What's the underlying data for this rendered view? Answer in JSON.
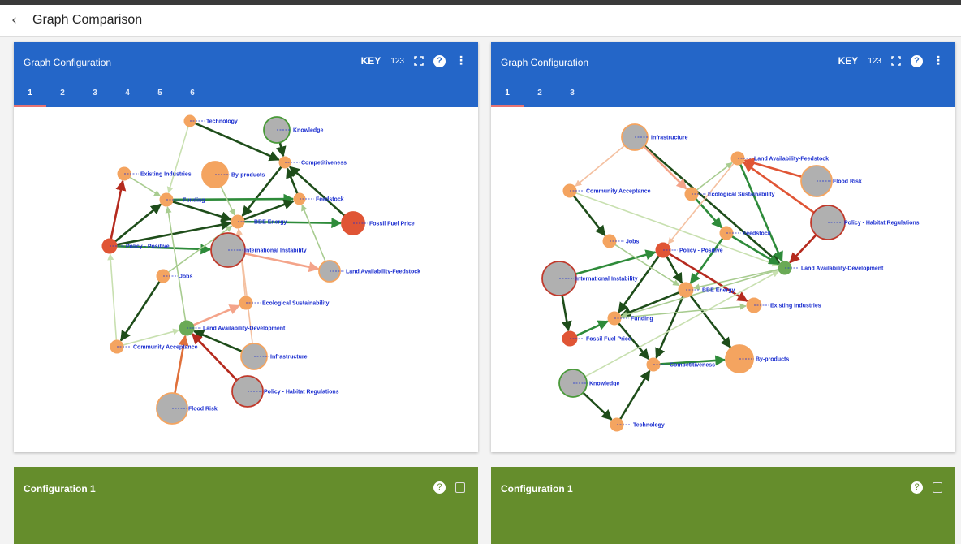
{
  "header": {
    "back_icon": "chevron-left-icon",
    "title": "Graph Comparison"
  },
  "panels": [
    {
      "title": "Graph Configuration",
      "key_label": "KEY",
      "count_label": "123",
      "tabs": [
        "1",
        "2",
        "3",
        "4",
        "5",
        "6"
      ],
      "active_tab": "1",
      "graph": {
        "nodes": [
          {
            "id": "technology",
            "label": "Technology",
            "fill": "#f4a460",
            "border": "#f4a460"
          },
          {
            "id": "knowledge",
            "label": "Knowledge",
            "fill": "#b0b0b0",
            "border": "#4a9a3a"
          },
          {
            "id": "competitiveness",
            "label": "Competitiveness",
            "fill": "#f4a460",
            "border": "#f4a460"
          },
          {
            "id": "existing_industries",
            "label": "Existing Industries",
            "fill": "#f4a460",
            "border": "#f4a460"
          },
          {
            "id": "byproducts",
            "label": "By-products",
            "fill": "#f4a460",
            "border": "#f4a460"
          },
          {
            "id": "funding",
            "label": "Funding",
            "fill": "#f4a460",
            "border": "#f4a460"
          },
          {
            "id": "feedstock",
            "label": "Feedstock",
            "fill": "#f4a460",
            "border": "#f4a460"
          },
          {
            "id": "bbe_energy",
            "label": "BBE Energy",
            "fill": "#f4a460",
            "border": "#f4a460"
          },
          {
            "id": "fossil_fuel_price",
            "label": "Fossil Fuel Price",
            "fill": "#e05535",
            "border": "#e05535"
          },
          {
            "id": "policy_positive",
            "label": "Policy - Positive",
            "fill": "#e05535",
            "border": "#e05535"
          },
          {
            "id": "international_instability",
            "label": "International Instability",
            "fill": "#b0b0b0",
            "border": "#c0392b"
          },
          {
            "id": "land_feedstock",
            "label": "Land Availability-Feedstock",
            "fill": "#b0b0b0",
            "border": "#f4a460"
          },
          {
            "id": "jobs",
            "label": "Jobs",
            "fill": "#f4a460",
            "border": "#f4a460"
          },
          {
            "id": "ecological",
            "label": "Ecological Sustainability",
            "fill": "#f4a460",
            "border": "#f4a460"
          },
          {
            "id": "land_development",
            "label": "Land Availability-Development",
            "fill": "#6aaa56",
            "border": "#6aaa56"
          },
          {
            "id": "community",
            "label": "Community Acceptance",
            "fill": "#f4a460",
            "border": "#f4a460"
          },
          {
            "id": "infrastructure",
            "label": "Infrastructure",
            "fill": "#b0b0b0",
            "border": "#f4a460"
          },
          {
            "id": "policy_habitat",
            "label": "Policy - Habitat Regulations",
            "fill": "#b0b0b0",
            "border": "#c0392b"
          },
          {
            "id": "flood_risk",
            "label": "Flood Risk",
            "fill": "#b0b0b0",
            "border": "#f4a460"
          }
        ],
        "edges": [
          [
            "technology",
            "competitiveness",
            "#1e4d1a"
          ],
          [
            "knowledge",
            "competitiveness",
            "#1e4d1a"
          ],
          [
            "competitiveness",
            "bbe_energy",
            "#1e4d1a"
          ],
          [
            "feedstock",
            "competitiveness",
            "#1e4d1a"
          ],
          [
            "policy_positive",
            "existing_industries",
            "#b52a1e"
          ],
          [
            "policy_positive",
            "funding",
            "#1e4d1a"
          ],
          [
            "funding",
            "bbe_energy",
            "#1e4d1a"
          ],
          [
            "funding",
            "feedstock",
            "#2e8b3a"
          ],
          [
            "bbe_energy",
            "feedstock",
            "#1e4d1a"
          ],
          [
            "bbe_energy",
            "fossil_fuel_price",
            "#2e8b3a"
          ],
          [
            "policy_positive",
            "bbe_energy",
            "#1e4d1a"
          ],
          [
            "policy_positive",
            "international_instability",
            "#2e8b3a"
          ],
          [
            "international_instability",
            "land_feedstock",
            "#f4a48a"
          ],
          [
            "jobs",
            "community",
            "#1e4d1a"
          ],
          [
            "infrastructure",
            "land_development",
            "#1e4d1a"
          ],
          [
            "policy_habitat",
            "land_development",
            "#b52a1e"
          ],
          [
            "flood_risk",
            "land_development",
            "#e0703a"
          ],
          [
            "land_development",
            "ecological",
            "#f4a48a"
          ],
          [
            "community",
            "land_development",
            "#c8e0b0"
          ],
          [
            "existing_industries",
            "funding",
            "#a8cc90"
          ],
          [
            "technology",
            "funding",
            "#c8e0b0"
          ],
          [
            "byproducts",
            "bbe_energy",
            "#a8cc90"
          ],
          [
            "ecological",
            "bbe_energy",
            "#f4c0a0"
          ],
          [
            "land_development",
            "funding",
            "#a8cc90"
          ],
          [
            "jobs",
            "bbe_energy",
            "#a8cc90"
          ],
          [
            "community",
            "policy_positive",
            "#c8e0b0"
          ],
          [
            "land_feedstock",
            "feedstock",
            "#a8cc90"
          ],
          [
            "infrastructure",
            "bbe_energy",
            "#f4c0a0"
          ],
          [
            "fossil_fuel_price",
            "competitiveness",
            "#1e4d1a"
          ]
        ]
      }
    },
    {
      "title": "Graph Configuration",
      "key_label": "KEY",
      "count_label": "123",
      "tabs": [
        "1",
        "2",
        "3"
      ],
      "active_tab": "1",
      "graph": {
        "nodes": [
          {
            "id": "infrastructure",
            "label": "Infrastructure",
            "fill": "#b0b0b0",
            "border": "#f4a460"
          },
          {
            "id": "land_feedstock",
            "label": "Land Availability-Feedstock",
            "fill": "#f4a460",
            "border": "#f4a460"
          },
          {
            "id": "flood_risk",
            "label": "Flood Risk",
            "fill": "#b0b0b0",
            "border": "#f4a460"
          },
          {
            "id": "community",
            "label": "Community Acceptance",
            "fill": "#f4a460",
            "border": "#f4a460"
          },
          {
            "id": "ecological",
            "label": "Ecological Sustainability",
            "fill": "#f4a460",
            "border": "#f4a460"
          },
          {
            "id": "policy_habitat",
            "label": "Policy - Habitat Regulations",
            "fill": "#b0b0b0",
            "border": "#c0392b"
          },
          {
            "id": "feedstock",
            "label": "Feedstock",
            "fill": "#f4a460",
            "border": "#f4a460"
          },
          {
            "id": "jobs",
            "label": "Jobs",
            "fill": "#f4a460",
            "border": "#f4a460"
          },
          {
            "id": "policy_positive",
            "label": "Policy - Positive",
            "fill": "#e05535",
            "border": "#e05535"
          },
          {
            "id": "land_development",
            "label": "Land Availability-Development",
            "fill": "#6aaa56",
            "border": "#6aaa56"
          },
          {
            "id": "international_instability",
            "label": "International Instability",
            "fill": "#b0b0b0",
            "border": "#c0392b"
          },
          {
            "id": "bbe_energy",
            "label": "BBE Energy",
            "fill": "#f4a460",
            "border": "#f4a460"
          },
          {
            "id": "existing_industries",
            "label": "Existing Industries",
            "fill": "#f4a460",
            "border": "#f4a460"
          },
          {
            "id": "funding",
            "label": "Funding",
            "fill": "#f4a460",
            "border": "#f4a460"
          },
          {
            "id": "fossil_fuel_price",
            "label": "Fossil Fuel Price",
            "fill": "#e05535",
            "border": "#e05535"
          },
          {
            "id": "competitiveness",
            "label": "Competitiveness",
            "fill": "#f4a460",
            "border": "#f4a460"
          },
          {
            "id": "byproducts",
            "label": "By-products",
            "fill": "#f4a460",
            "border": "#f4a460"
          },
          {
            "id": "knowledge",
            "label": "Knowledge",
            "fill": "#b0b0b0",
            "border": "#4a9a3a"
          },
          {
            "id": "technology",
            "label": "Technology",
            "fill": "#f4a460",
            "border": "#f4a460"
          }
        ],
        "edges": [
          [
            "infrastructure",
            "land_development",
            "#1e4d1a"
          ],
          [
            "land_feedstock",
            "land_development",
            "#2e8b3a"
          ],
          [
            "flood_risk",
            "land_feedstock",
            "#e05535"
          ],
          [
            "policy_habitat",
            "land_feedstock",
            "#e05535"
          ],
          [
            "policy_habitat",
            "land_development",
            "#b52a1e"
          ],
          [
            "ecological",
            "land_feedstock",
            "#a8cc90"
          ],
          [
            "community",
            "jobs",
            "#1e4d1a"
          ],
          [
            "feedstock",
            "bbe_energy",
            "#2e8b3a"
          ],
          [
            "policy_positive",
            "bbe_energy",
            "#1e4d1a"
          ],
          [
            "policy_positive",
            "existing_industries",
            "#b52a1e"
          ],
          [
            "policy_positive",
            "funding",
            "#1e4d1a"
          ],
          [
            "international_instability",
            "fossil_fuel_price",
            "#1e4d1a"
          ],
          [
            "international_instability",
            "policy_positive",
            "#2e8b3a"
          ],
          [
            "bbe_energy",
            "competitiveness",
            "#1e4d1a"
          ],
          [
            "bbe_energy",
            "byproducts",
            "#1e4d1a"
          ],
          [
            "bbe_energy",
            "funding",
            "#1e4d1a"
          ],
          [
            "funding",
            "competitiveness",
            "#1e4d1a"
          ],
          [
            "fossil_fuel_price",
            "funding",
            "#2e8b3a"
          ],
          [
            "knowledge",
            "technology",
            "#1e4d1a"
          ],
          [
            "technology",
            "competitiveness",
            "#1e4d1a"
          ],
          [
            "competitiveness",
            "byproducts",
            "#2e8b3a"
          ],
          [
            "funding",
            "existing_industries",
            "#a8cc90"
          ],
          [
            "land_development",
            "bbe_energy",
            "#a8cc90"
          ],
          [
            "land_development",
            "funding",
            "#a8cc90"
          ],
          [
            "jobs",
            "bbe_energy",
            "#a8cc90"
          ],
          [
            "community",
            "land_development",
            "#c8e0b0"
          ],
          [
            "ecological",
            "feedstock",
            "#2e8b3a"
          ],
          [
            "land_feedstock",
            "policy_positive",
            "#f4c0a0"
          ],
          [
            "infrastructure",
            "community",
            "#f4c0a0"
          ],
          [
            "feedstock",
            "land_development",
            "#2e8b3a"
          ],
          [
            "knowledge",
            "land_development",
            "#c8e0b0"
          ],
          [
            "infrastructure",
            "ecological",
            "#f4a48a"
          ]
        ]
      }
    }
  ],
  "configs": [
    {
      "title": "Configuration 1"
    },
    {
      "title": "Configuration 1"
    }
  ]
}
